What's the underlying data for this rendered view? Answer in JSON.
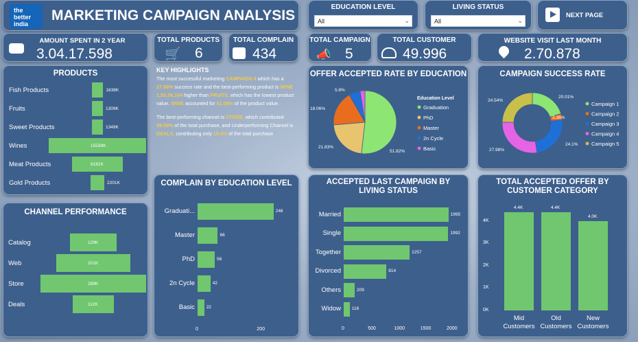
{
  "header": {
    "title": "MARKETING CAMPAIGN ANALYSIS",
    "logo": "the better india"
  },
  "filters": {
    "education": {
      "label": "EDUCATION LEVEL",
      "value": "All"
    },
    "living": {
      "label": "LIVING STATUS",
      "value": "All"
    },
    "next": "NEXT PAGE"
  },
  "kpis": {
    "amount": {
      "label": "AMOUNT SPENT IN 2 YEAR",
      "value": "3.04.17.598"
    },
    "products": {
      "label": "TOTAL PRODUCTS",
      "value": "6"
    },
    "complain": {
      "label": "TOTAL COMPLAIN",
      "value": "434"
    },
    "campaign": {
      "label": "TOTAL CAMPAIGN",
      "value": "5"
    },
    "customer": {
      "label": "TOTAL CUSTOMER",
      "value": "49.996"
    },
    "visit": {
      "label": "WEBSITE VISIT LAST MONTH",
      "value": "2.70.878"
    }
  },
  "highlights": {
    "title": "KEY HIGHLIGHTS",
    "p1": [
      [
        "The most successful marketing ",
        ""
      ],
      [
        "CAMPAIGN 4",
        "y"
      ],
      [
        " which has a ",
        ""
      ],
      [
        "27.98%",
        "y"
      ],
      [
        " success rate and the best-performing product is ",
        ""
      ],
      [
        "WINE 1,55,39,104",
        "y"
      ],
      [
        " higher than ",
        ""
      ],
      [
        "FRUITS,",
        "y"
      ],
      [
        " which has the lowest product value. ",
        ""
      ],
      [
        "WINE",
        "y"
      ],
      [
        " accounted for ",
        ""
      ],
      [
        "51.08%",
        "y"
      ],
      [
        " of the product value.",
        ""
      ]
    ],
    "p2": [
      [
        "The best-performing channel is ",
        ""
      ],
      [
        "STORE,",
        "y"
      ],
      [
        " which contributed ",
        ""
      ],
      [
        "39.59%",
        "y"
      ],
      [
        " of the total purchase, and Underperforming Channel is ",
        ""
      ],
      [
        "DEALS,",
        "y"
      ],
      [
        " contributing only ",
        ""
      ],
      [
        "15.4%",
        "y"
      ],
      [
        " of the total purchase",
        ""
      ]
    ]
  },
  "colors": {
    "bar": "#70c76f",
    "card": "#3d5f8c",
    "highlight": "#f2c94c",
    "pie": [
      "#8de573",
      "#e8c46f",
      "#e96d1f",
      "#1f6fd8",
      "#e563e5"
    ]
  },
  "chart_data": [
    {
      "id": "products",
      "type": "bar",
      "title": "PRODUCTS",
      "categories": [
        "Fish Products",
        "Fruits",
        "Sweet Products",
        "Wines",
        "Meat Products",
        "Gold Products"
      ],
      "values": [
        1838,
        1309,
        1349,
        15539,
        8181,
        2201
      ],
      "labels": [
        "1838K",
        "1309K",
        "1349K",
        "15539K",
        "8181K",
        "2201K"
      ]
    },
    {
      "id": "channel",
      "type": "bar",
      "title": "CHANNEL PERFORMANCE",
      "categories": [
        "Catalog",
        "Web",
        "Store",
        "Deals"
      ],
      "values": [
        129,
        201,
        289,
        112
      ],
      "labels": [
        "129K",
        "201K",
        "289K",
        "112K"
      ]
    },
    {
      "id": "education_pie",
      "type": "pie",
      "title": "OFFER ACCEPTED RATE BY EDUCATION",
      "legend_title": "Education Level",
      "categories": [
        "Graduation",
        "PhD",
        "Master",
        "2n Cycle",
        "Basic"
      ],
      "values": [
        51.82,
        21.83,
        18.06,
        5.8,
        2.49
      ],
      "labels": [
        "51.82%",
        "21.83%",
        "18.06%",
        "5.8%",
        ""
      ]
    },
    {
      "id": "campaign_donut",
      "type": "pie",
      "title": "CAMPAIGN SUCCESS RATE",
      "categories": [
        "Campaign 1",
        "Campaign 2",
        "Campaign 3",
        "Campaign 4",
        "Campaign 5"
      ],
      "values": [
        20.01,
        3.36,
        24.1,
        27.98,
        24.54
      ],
      "labels": [
        "20.01%",
        "3.36%",
        "24.1%",
        "27.98%",
        "24.54%"
      ],
      "colors": [
        "#8de573",
        "#e96d1f",
        "#1f6fd8",
        "#e563e5",
        "#c8c04a"
      ]
    },
    {
      "id": "complain",
      "type": "bar",
      "title": "COMPLAIN BY EDUCATION LEVEL",
      "categories": [
        "Graduati...",
        "Master",
        "PhD",
        "2n Cycle",
        "Basic"
      ],
      "values": [
        248,
        66,
        56,
        42,
        22
      ],
      "xticks": [
        "0",
        "200"
      ],
      "xmax": 280
    },
    {
      "id": "living",
      "type": "bar",
      "title": "ACCEPTED LAST CAMPAIGN BY LIVING STATUS",
      "categories": [
        "Married",
        "Single",
        "Together",
        "Divorced",
        "Others",
        "Widow"
      ],
      "values": [
        1995,
        1992,
        1257,
        814,
        209,
        116
      ],
      "xticks": [
        "0",
        "500",
        "1000",
        "1500",
        "2000"
      ],
      "xmax": 2000
    },
    {
      "id": "customer",
      "type": "bar",
      "title": "TOTAL ACCEPTED OFFER BY CUSTOMER CATEGORY",
      "categories": [
        "Mid Customers",
        "Old Customers",
        "New Customers"
      ],
      "values": [
        4.4,
        4.4,
        4.0
      ],
      "labels": [
        "4.4K",
        "4.4K",
        "4.0K"
      ],
      "yticks": [
        "0K",
        "1K",
        "2K",
        "3K",
        "4K"
      ],
      "ymax": 4.6
    }
  ]
}
